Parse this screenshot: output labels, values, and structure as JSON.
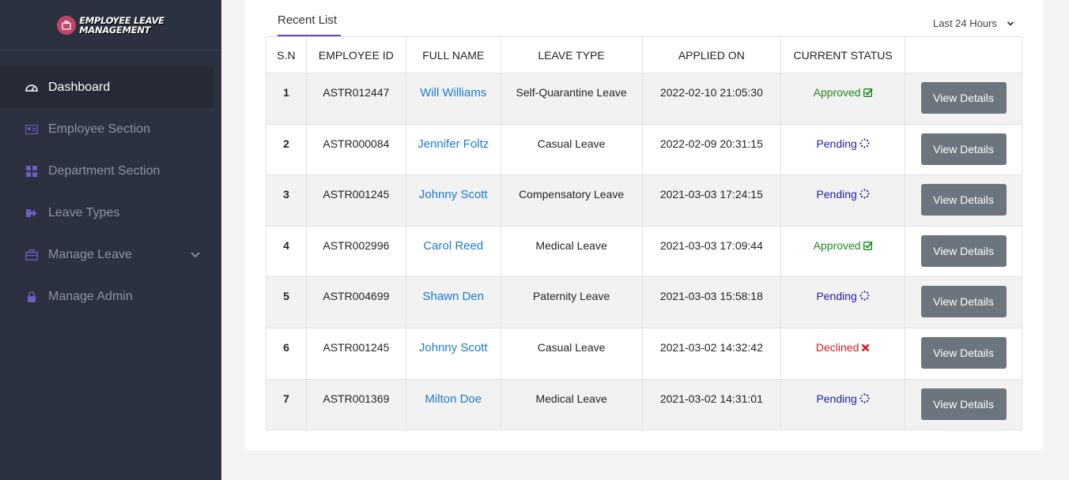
{
  "logo": {
    "line1": "Employee Leave",
    "line2": "Management"
  },
  "sidebar": {
    "items": [
      {
        "label": "Dashboard",
        "icon": "gauge-icon",
        "active": true
      },
      {
        "label": "Employee Section",
        "icon": "id-card-icon"
      },
      {
        "label": "Department Section",
        "icon": "grid-icon"
      },
      {
        "label": "Leave Types",
        "icon": "sign-out-icon"
      },
      {
        "label": "Manage Leave",
        "icon": "briefcase-icon",
        "has_submenu": true
      },
      {
        "label": "Manage Admin",
        "icon": "lock-icon"
      }
    ]
  },
  "main": {
    "tab": "Recent List",
    "filter": "Last 24 Hours",
    "table": {
      "headers": [
        "S.N",
        "EMPLOYEE ID",
        "FULL NAME",
        "LEAVE TYPE",
        "APPLIED ON",
        "CURRENT STATUS",
        ""
      ],
      "action_label": "View Details",
      "rows": [
        {
          "sn": "1",
          "id": "ASTR012447",
          "name": "Will Williams",
          "type": "Self-Quarantine Leave",
          "applied": "2022-02-10 21:05:30",
          "status": "Approved"
        },
        {
          "sn": "2",
          "id": "ASTR000084",
          "name": "Jennifer Foltz",
          "type": "Casual Leave",
          "applied": "2022-02-09 20:31:15",
          "status": "Pending"
        },
        {
          "sn": "3",
          "id": "ASTR001245",
          "name": "Johnny Scott",
          "type": "Compensatory Leave",
          "applied": "2021-03-03 17:24:15",
          "status": "Pending"
        },
        {
          "sn": "4",
          "id": "ASTR002996",
          "name": "Carol Reed",
          "type": "Medical Leave",
          "applied": "2021-03-03 17:09:44",
          "status": "Approved"
        },
        {
          "sn": "5",
          "id": "ASTR004699",
          "name": "Shawn Den",
          "type": "Paternity Leave",
          "applied": "2021-03-03 15:58:18",
          "status": "Pending"
        },
        {
          "sn": "6",
          "id": "ASTR001245",
          "name": "Johnny Scott",
          "type": "Casual Leave",
          "applied": "2021-03-02 14:32:42",
          "status": "Declined"
        },
        {
          "sn": "7",
          "id": "ASTR001369",
          "name": "Milton Doe",
          "type": "Medical Leave",
          "applied": "2021-03-02 14:31:01",
          "status": "Pending"
        }
      ]
    }
  },
  "colors": {
    "sidebar_bg": "#2c3140",
    "accent": "#6c3fc9",
    "link": "#1a7bd3",
    "approved": "#1e8a1e",
    "pending": "#1f1fa8",
    "declined": "#d41e1e",
    "button": "#6c757d"
  }
}
